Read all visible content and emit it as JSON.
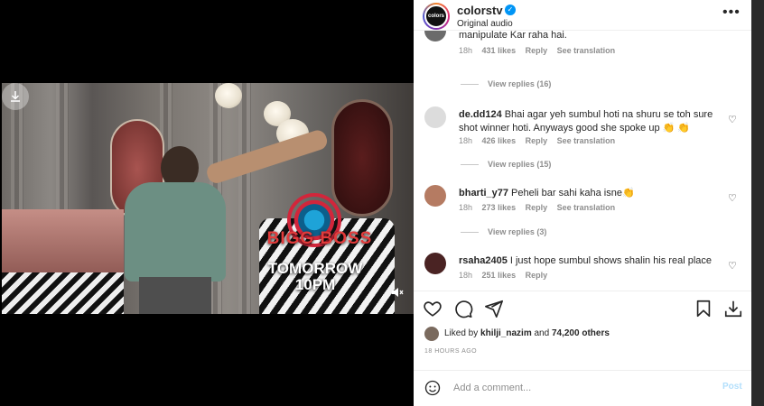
{
  "post": {
    "username": "colorstv",
    "audio": "Original audio",
    "avatar_text": "colors",
    "more_icon": "more-horizontal-icon"
  },
  "video": {
    "overlay_title": "BIGG BOSS",
    "overlay_time1": "TOMORROW",
    "overlay_time2": "10PM"
  },
  "comments": [
    {
      "username": "",
      "text": "manipulate Kar raha hai.",
      "time": "18h",
      "likes": "431 likes",
      "reply": "Reply",
      "translate": "See translation",
      "replies": "View replies (16)"
    },
    {
      "username": "de.dd124",
      "text": "Bhai agar yeh sumbul hoti na shuru se toh sure shot winner hoti. Anyways good she spoke up 👏 👏",
      "time": "18h",
      "likes": "426 likes",
      "reply": "Reply",
      "translate": "See translation",
      "replies": "View replies (15)"
    },
    {
      "username": "bharti_y77",
      "text": "Peheli bar sahi kaha isne👏",
      "time": "18h",
      "likes": "273 likes",
      "reply": "Reply",
      "translate": "See translation",
      "replies": "View replies (3)"
    },
    {
      "username": "rsaha2405",
      "text": "I just hope sumbul shows shalin his real place",
      "time": "18h",
      "likes": "251 likes",
      "reply": "Reply"
    }
  ],
  "likes": {
    "prefix": "Liked by",
    "user": "khilji_nazim",
    "mid": "and",
    "others": "74,200 others"
  },
  "time_ago": "18 HOURS AGO",
  "add_comment": {
    "placeholder": "Add a comment...",
    "post_label": "Post"
  },
  "colors": {
    "accent": "#0095f6",
    "text": "#262626",
    "muted": "#8e8e8e"
  }
}
